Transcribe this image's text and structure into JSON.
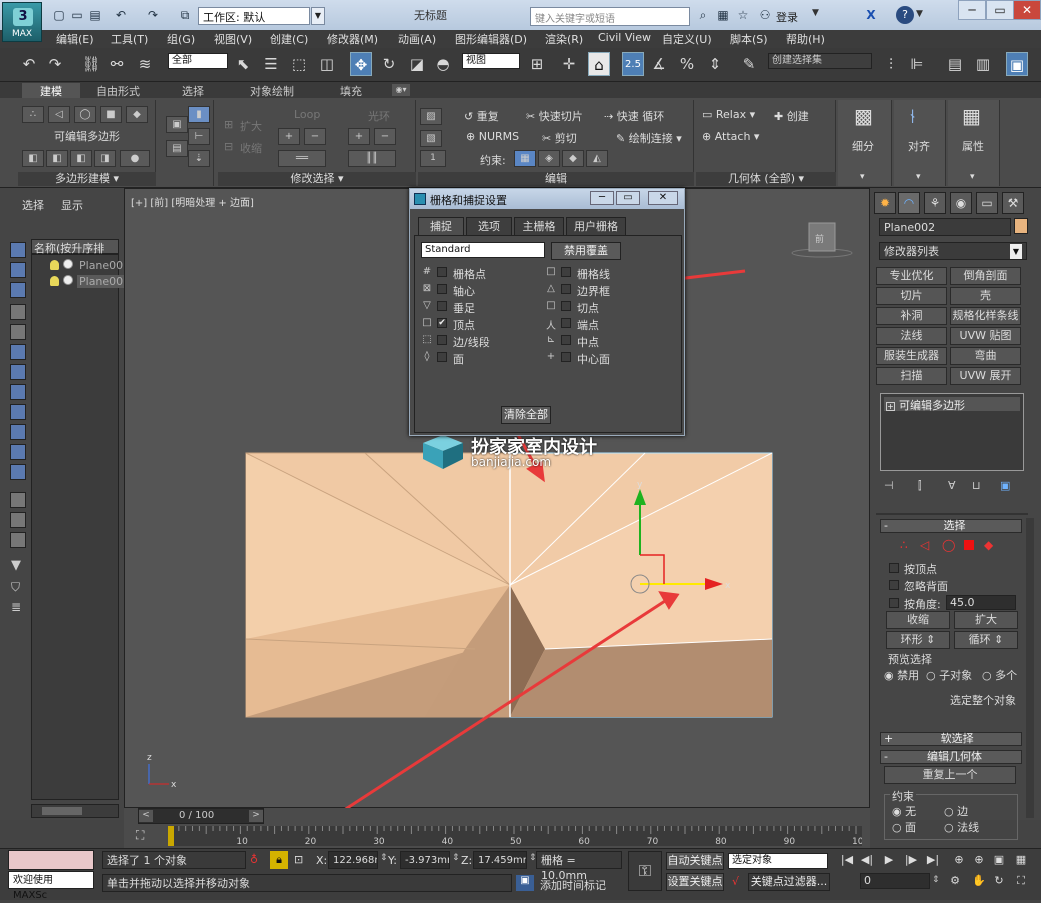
{
  "titlebar": {
    "logo_text": "MAX",
    "workspace_label": "工作区: 默认",
    "window_title": "无标题",
    "search_placeholder": "键入关键字或短语",
    "login_label": "登录",
    "help_label": "?"
  },
  "menu": [
    "编辑(E)",
    "工具(T)",
    "组(G)",
    "视图(V)",
    "创建(C)",
    "修改器(M)",
    "动画(A)",
    "图形编辑器(D)",
    "渲染(R)",
    "Civil View",
    "自定义(U)",
    "脚本(S)",
    "帮助(H)"
  ],
  "main_toolbar": {
    "selection_filter": "全部",
    "reference_coord": "视图",
    "snap_value": "2.5",
    "named_selection": "创建选择集"
  },
  "ribbon_tabs": [
    "建模",
    "自由形式",
    "选择",
    "对象绘制",
    "填充"
  ],
  "ribbon": {
    "poly_label": "可编辑多边形",
    "group_poly_modeling": "多边形建模",
    "group_modify_selection": "修改选择",
    "group_edit": "编辑",
    "group_geometry": "几何体 (全部)",
    "grow": "扩大",
    "shrink": "收缩",
    "loop": "Loop",
    "ring": "光环",
    "repeat": "重复",
    "nurms": "NURMS",
    "quickslice": "快速切片",
    "cut": "剪切",
    "swiftloop": "快速 循环",
    "paintconnect": "绘制连接",
    "constraints": "约束:",
    "relax": "Relax",
    "create": "创建",
    "attach": "Attach",
    "subdivide": "细分",
    "align": "对齐",
    "properties": "属性",
    "spinner_value": "1"
  },
  "left_panel": {
    "tab_select": "选择",
    "tab_display": "显示",
    "scene_header": "名称(按升序排序)",
    "items": [
      "Plane00",
      "Plane00"
    ]
  },
  "viewport": {
    "label": "[+] [前] [明暗处理 + 边面]",
    "gizmo_axis_x": "x",
    "gizmo_axis_y": "y",
    "world_axis_x": "x",
    "world_axis_z": "z",
    "nav_cube_label": "前",
    "watermark_title": "扮家家室内设计",
    "watermark_url": "banjiajia.com"
  },
  "snap_dialog": {
    "title": "栅格和捕捉设置",
    "tabs": [
      "捕捉",
      "选项",
      "主栅格",
      "用户栅格"
    ],
    "preset": "Standard",
    "override_btn": "禁用覆盖",
    "left_items": [
      {
        "label": "栅格点",
        "checked": false,
        "symbol": "#"
      },
      {
        "label": "轴心",
        "checked": false,
        "symbol": "⊠"
      },
      {
        "label": "垂足",
        "checked": false,
        "symbol": "▽"
      },
      {
        "label": "顶点",
        "checked": true,
        "symbol": "□"
      },
      {
        "label": "边/线段",
        "checked": false,
        "symbol": "⬚"
      },
      {
        "label": "面",
        "checked": false,
        "symbol": "◊"
      }
    ],
    "right_items": [
      {
        "label": "栅格线",
        "checked": false,
        "symbol": "□"
      },
      {
        "label": "边界框",
        "checked": false,
        "symbol": "△"
      },
      {
        "label": "切点",
        "checked": false,
        "symbol": "□"
      },
      {
        "label": "端点",
        "checked": false,
        "symbol": "人"
      },
      {
        "label": "中点",
        "checked": false,
        "symbol": "⊾"
      },
      {
        "label": "中心面",
        "checked": false,
        "symbol": "+"
      }
    ],
    "clear_btn": "清除全部"
  },
  "command_panel": {
    "object_name": "Plane002",
    "object_color": "#e8b47f",
    "modifier_list": "修改器列表",
    "buttons": [
      "专业优化",
      "倒角剖面",
      "切片",
      "壳",
      "补洞",
      "规格化样条线",
      "法线",
      "UVW 贴图",
      "服装生成器",
      "弯曲",
      "扫描",
      "UVW 展开"
    ],
    "stack_item": "可编辑多边形",
    "selection_header": "选择",
    "by_vertex": "按顶点",
    "ignore_backfacing": "忽略背面",
    "by_angle": "按角度:",
    "angle_value": "45.0",
    "shrink": "收缩",
    "grow": "扩大",
    "ring": "环形",
    "loop": "循环",
    "preview_label": "预览选择",
    "preview_options": [
      "禁用",
      "子对象",
      "多个"
    ],
    "select_whole": "选定整个对象",
    "soft_selection": "软选择",
    "edit_geometry": "编辑几何体",
    "repeat_last": "重复上一个",
    "constraints_label": "约束",
    "constraint_options": [
      "无",
      "边",
      "面",
      "法线"
    ]
  },
  "timeline": {
    "frame_counter": "0 / 100",
    "ticks": [
      "0",
      "10",
      "20",
      "30",
      "40",
      "50",
      "60",
      "70",
      "80",
      "90",
      "100"
    ]
  },
  "status": {
    "maxscript_label": "欢迎使用 MAXSc",
    "selection_info": "选择了 1 个对象",
    "prompt": "单击并拖动以选择并移动对象",
    "x_label": "X:",
    "x_value": "122.968mm",
    "y_label": "Y:",
    "y_value": "-3.973mm",
    "z_label": "Z:",
    "z_value": "17.459mm",
    "grid": "栅格 = 10.0mm",
    "add_time_tag": "添加时间标记",
    "auto_key": "自动关键点",
    "set_key": "设置关键点",
    "key_mode": "选定对象",
    "key_filters": "关键点过滤器...",
    "frame_value": "0"
  },
  "colors": {
    "plane_light": "#f1c8a3",
    "plane_dark": "#a88468",
    "annotation_arrow": "#e83a3a",
    "selection_blue": "#4e7fb5"
  }
}
